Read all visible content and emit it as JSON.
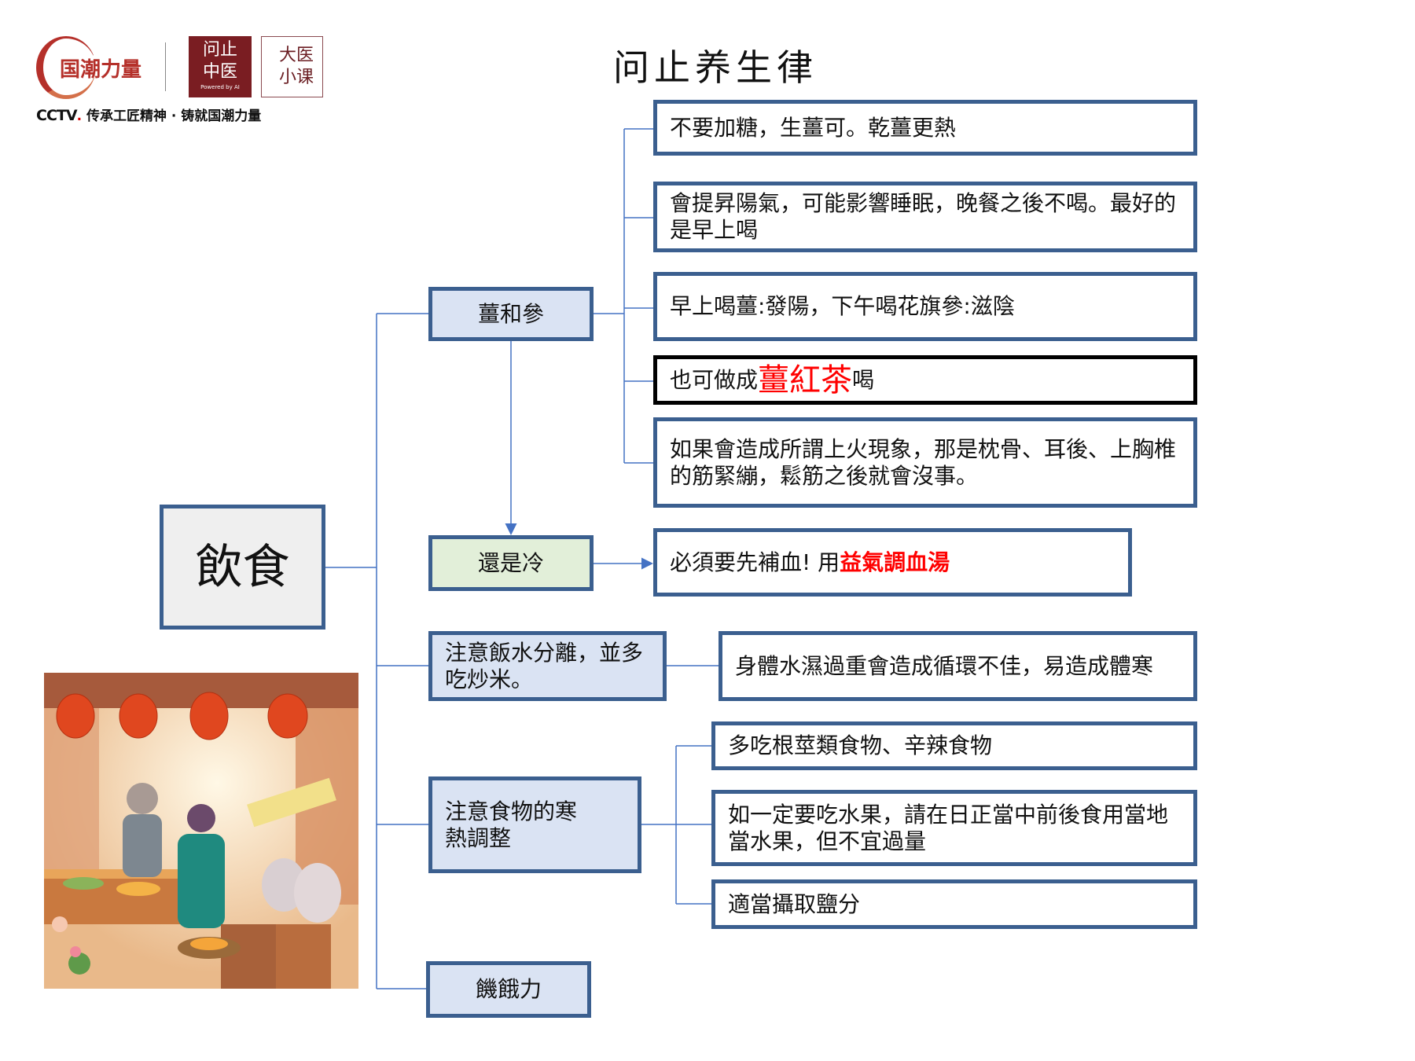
{
  "logos": {
    "brand": "国潮力量",
    "wenzhi_line1": "问止",
    "wenzhi_line2": "中医",
    "powered": "Powered by AI",
    "small_mark": "问止",
    "course_line1": "大医",
    "course_line2": "小课",
    "cctv": "CCTV",
    "cctv_slogan": "传承工匠精神 · 铸就国潮力量"
  },
  "title": "问止养生律",
  "root": "飲食",
  "nodes": {
    "ginger": {
      "label": "薑和參",
      "children": [
        {
          "text": "不要加糖，生薑可。乾薑更熱"
        },
        {
          "text": "會提昇陽氣，可能影響睡眠，晚餐之後不喝。最好的是早上喝"
        },
        {
          "text": "早上喝薑:發陽，下午喝花旗參:滋陰"
        },
        {
          "pre": "也可做成",
          "highlight": "薑紅茶",
          "post": "喝"
        },
        {
          "text": "如果會造成所謂上火現象，那是枕骨、耳後、上胸椎的筋緊繃，鬆筋之後就會沒事。"
        }
      ]
    },
    "cold": {
      "label": "還是冷",
      "child": {
        "pre": "必須要先補血! 用",
        "highlight": "益氣調血湯"
      }
    },
    "rice": {
      "label": "注意飯水分離，並多吃炒米。",
      "child": "身體水濕過重會造成循環不佳，易造成體寒"
    },
    "food": {
      "label": "注意食物的寒熱調整",
      "children": [
        "多吃根莖類食物、辛辣食物",
        "如一定要吃水果，請在日正當中前後食用當地當水果，但不宜過量",
        "適當攝取鹽分"
      ]
    },
    "hunger": {
      "label": "饑餓力"
    }
  },
  "colors": {
    "border": "#3b5f8f",
    "node_fill": "#dae3f3",
    "green_fill": "#e2efd9",
    "root_fill": "#efefef",
    "line": "#4472c4",
    "highlight": "#ff0000"
  }
}
